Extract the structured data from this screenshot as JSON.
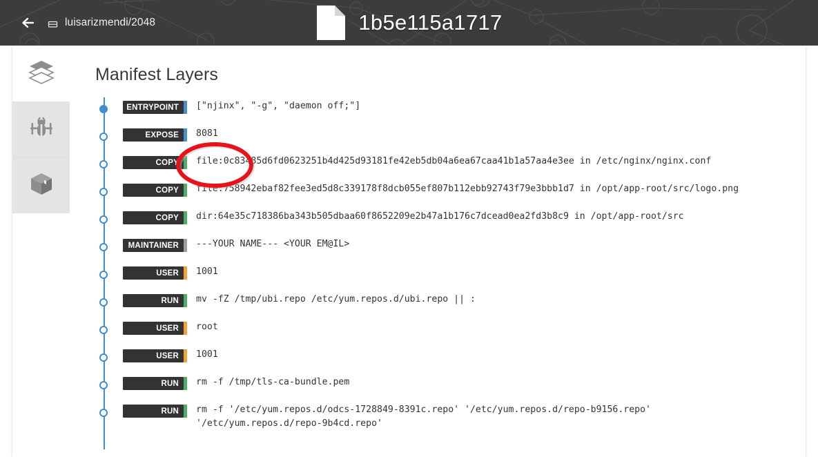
{
  "header": {
    "back_icon": "back-arrow-icon",
    "lock_icon": "lock-icon",
    "repository": "luisarizmendi/2048",
    "file_icon": "file-document-icon",
    "image_title": "1b5e115a1717",
    "background_color": "#3c3c3c"
  },
  "sidebar": {
    "items": [
      {
        "icon": "layers-icon",
        "name": "sidebar-item-layers",
        "active": true
      },
      {
        "icon": "bug-icon",
        "name": "sidebar-item-security",
        "active": false
      },
      {
        "icon": "package-icon",
        "name": "sidebar-item-packages",
        "active": false
      }
    ]
  },
  "main": {
    "section_title": "Manifest Layers",
    "accent_colors": {
      "blue": "#4a90c4",
      "green": "#4caf64",
      "gray": "#9e9e9e",
      "orange": "#f0a43a",
      "timeline": "#3f8ed0"
    },
    "layers": [
      {
        "command": "ENTRYPOINT",
        "accent": "blue",
        "text": "[\"njinx\", \"-g\", \"daemon off;\"]"
      },
      {
        "command": "EXPOSE",
        "accent": "blue",
        "text": "8081"
      },
      {
        "command": "COPY",
        "accent": "green",
        "text": "file:0c83485d6fd0623251b4d425d93181fe42eb5db04a6ea67caa41b1a57aa4e3ee in /etc/nginx/nginx.conf"
      },
      {
        "command": "COPY",
        "accent": "green",
        "text": "file:758942ebaf82fee3ed5d8c339178f8dcb055ef807b112ebb92743f79e3bbb1d7 in /opt/app-root/src/logo.png"
      },
      {
        "command": "COPY",
        "accent": "green",
        "text": "dir:64e35c718386ba343b505dbaa60f8652209e2b47a1b176c7dcead0ea2fd3b8c9 in /opt/app-root/src"
      },
      {
        "command": "MAINTAINER",
        "accent": "gray",
        "text": "---YOUR NAME--- <YOUR EM@IL>"
      },
      {
        "command": "USER",
        "accent": "orange",
        "text": "1001"
      },
      {
        "command": "RUN",
        "accent": "green",
        "text": "mv -fZ /tmp/ubi.repo /etc/yum.repos.d/ubi.repo || :"
      },
      {
        "command": "USER",
        "accent": "orange",
        "text": "root"
      },
      {
        "command": "USER",
        "accent": "orange",
        "text": "1001"
      },
      {
        "command": "RUN",
        "accent": "green",
        "text": "rm -f /tmp/tls-ca-bundle.pem"
      },
      {
        "command": "RUN",
        "accent": "green",
        "text": "rm -f '/etc/yum.repos.d/odcs-1728849-8391c.repo' '/etc/yum.repos.d/repo-b9156.repo'\n'/etc/yum.repos.d/repo-9b4cd.repo'"
      }
    ]
  },
  "annotation": {
    "name": "red-ellipse-highlight",
    "color": "#e8121a",
    "targets_layer_index": 0
  }
}
